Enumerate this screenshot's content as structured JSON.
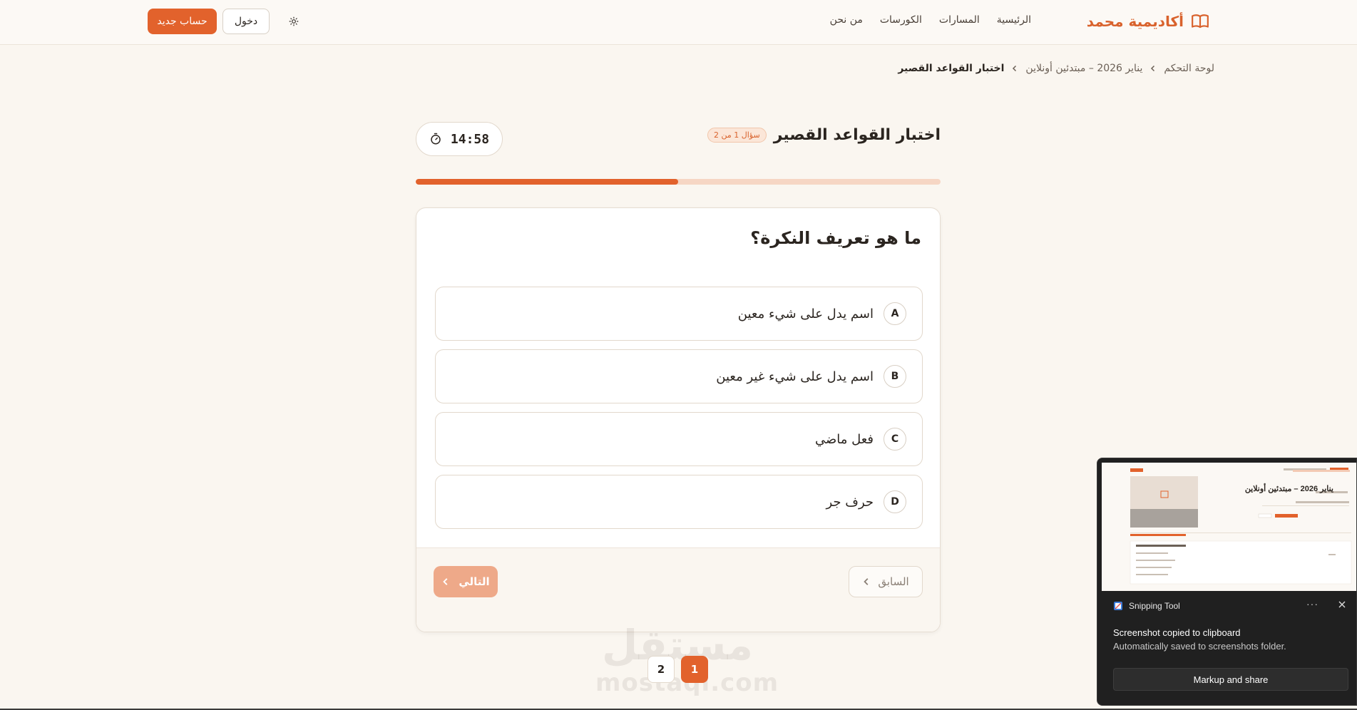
{
  "header": {
    "brand_name": "أكاديمية محمد",
    "brand_icon": "open-book-icon",
    "nav": [
      "الرئيسية",
      "المسارات",
      "الكورسات",
      "من نحن"
    ],
    "theme_icon": "sun-icon",
    "login_label": "دخول",
    "signup_label": "حساب جديد"
  },
  "breadcrumb": {
    "items": [
      "لوحة التحكم",
      "يناير 2026 – مبتدئين أونلاين",
      "اختبار القواعد القصير"
    ]
  },
  "quiz": {
    "title": "اختبار القواعد القصير",
    "badge": "سؤال 1 من 2",
    "timer": "14:58",
    "timer_icon": "stopwatch-icon",
    "progress": 0.5,
    "question": "ما هو تعريف النكرة؟",
    "options": [
      {
        "letter": "A",
        "text": "اسم يدل على شيء معين"
      },
      {
        "letter": "B",
        "text": "اسم يدل على شيء غير معين"
      },
      {
        "letter": "C",
        "text": "فعل ماضي"
      },
      {
        "letter": "D",
        "text": "حرف جر"
      }
    ],
    "prev_label": "السابق",
    "next_label": "التالي"
  },
  "pagination": {
    "pages": [
      "2",
      "1"
    ],
    "active": "1"
  },
  "watermark": {
    "arabic": "مستقل",
    "latin": "mostaql.com"
  },
  "toast": {
    "app_name": "Snipping Tool",
    "title": "Screenshot copied to clipboard",
    "subtitle": "Automatically saved to screenshots folder.",
    "action": "Markup and share",
    "thumb_title": "يناير 2026 – مبتدئين أونلاين"
  },
  "colors": {
    "accent": "#e2622c",
    "accent_light": "#eea989",
    "background": "#faf6f0",
    "card": "#ffffff",
    "toast_bg": "#202020"
  }
}
